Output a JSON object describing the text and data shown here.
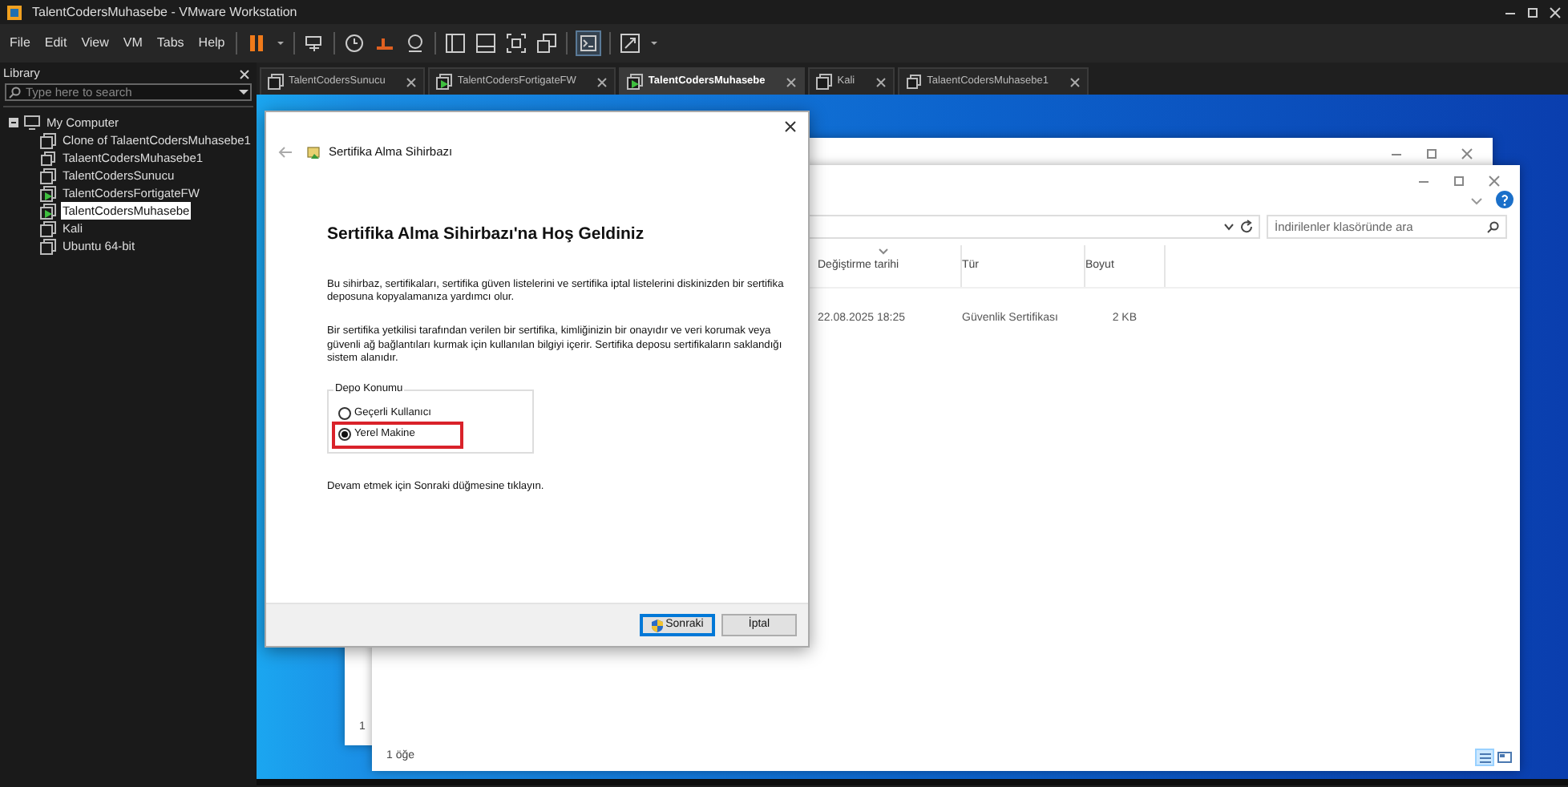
{
  "app_window": {
    "title": "TalentCodersMuhasebe - VMware Workstation"
  },
  "menu": [
    "File",
    "Edit",
    "View",
    "VM",
    "Tabs",
    "Help"
  ],
  "library": {
    "title": "Library",
    "search": {
      "placeholder": "Type here to search"
    },
    "tree": [
      {
        "label": "My Computer",
        "expanded": true,
        "selected": false,
        "children": [
          {
            "label": "Clone of TalaentCodersMuhasebe1",
            "kind": "vm",
            "running": false,
            "selected": false
          },
          {
            "label": "TalaentCodersMuhasebe1",
            "kind": "linked",
            "running": false,
            "selected": false
          },
          {
            "label": "TalentCodersSunucu",
            "kind": "vm",
            "running": false,
            "selected": false
          },
          {
            "label": "TalentCodersFortigateFW",
            "kind": "vm",
            "running": true,
            "selected": false
          },
          {
            "label": "TalentCodersMuhasebe",
            "kind": "vm",
            "running": true,
            "selected": true
          },
          {
            "label": "Kali",
            "kind": "vm",
            "running": false,
            "selected": false
          },
          {
            "label": "Ubuntu 64-bit",
            "kind": "vm",
            "running": false,
            "selected": false
          }
        ]
      }
    ]
  },
  "tabs": [
    {
      "label": "TalentCodersSunucu",
      "kind": "vm",
      "running": false,
      "selected": false
    },
    {
      "label": "TalentCodersFortigateFW",
      "kind": "vm",
      "running": true,
      "selected": false
    },
    {
      "label": "TalentCodersMuhasebe",
      "kind": "vm",
      "running": true,
      "selected": true
    },
    {
      "label": "Kali",
      "kind": "vm",
      "running": false,
      "selected": false
    },
    {
      "label": "TalaentCodersMuhasebe1",
      "kind": "linked",
      "running": false,
      "selected": false
    }
  ],
  "back_explorer": {
    "status": "1"
  },
  "explorer": {
    "search": {
      "placeholder": "İndirilenler klasöründe ara"
    },
    "columns": [
      {
        "label": "Değiştirme tarihi",
        "sorted": true
      },
      {
        "label": "Tür",
        "sorted": false
      },
      {
        "label": "Boyut",
        "sorted": false
      }
    ],
    "rows": [
      [
        "22.08.2025 18:25",
        "Güvenlik Sertifikası",
        "2 KB"
      ]
    ],
    "status": "1 öğe",
    "views": [
      {
        "kind": "details",
        "selected": true
      },
      {
        "kind": "tiles",
        "selected": false
      }
    ]
  },
  "dialog": {
    "title": "Sertifika Alma Sihirbazı",
    "heading": "Sertifika Alma Sihirbazı'na Hoş Geldiniz",
    "paragraphs": [
      "Bu sihirbaz, sertifikaları, sertifika güven listelerini ve sertifika iptal listelerini diskinizden bir sertifika deposuna kopyalamanıza yardımcı olur.",
      "Bir sertifika yetkilisi tarafından verilen bir sertifika, kimliğinizin bir onayıdır ve veri korumak veya güvenli ağ bağlantıları kurmak için kullanılan bilgiyi içerir. Sertifika deposu sertifikaların saklandığı sistem alanıdır."
    ],
    "store_location": {
      "legend": "Depo Konumu",
      "options": [
        {
          "label": "Geçerli Kullanıcı",
          "selected": false,
          "highlighted": false
        },
        {
          "label": "Yerel Makine",
          "selected": true,
          "highlighted": true
        }
      ]
    },
    "instruction": "Devam etmek için Sonraki düğmesine tıklayın.",
    "buttons": [
      {
        "label": "Sonraki",
        "default": true,
        "kind": "shield"
      },
      {
        "label": "İptal",
        "default": false,
        "kind": "plain"
      }
    ]
  }
}
